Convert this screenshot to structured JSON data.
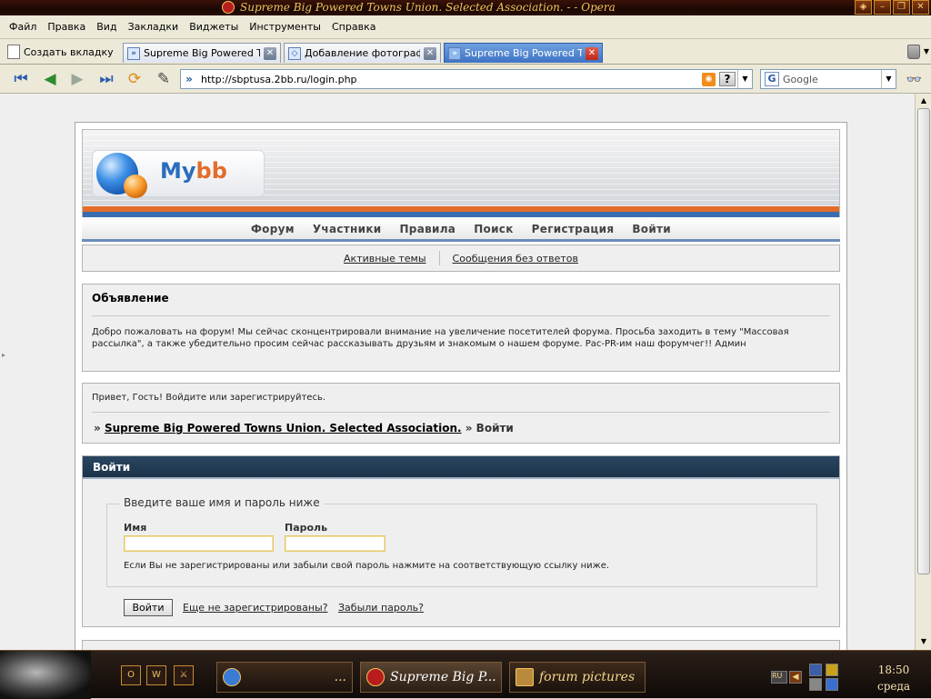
{
  "window": {
    "title": "Supreme Big Powered Towns Union. Selected Association. -      - Opera"
  },
  "menu": [
    "Файл",
    "Правка",
    "Вид",
    "Закладки",
    "Виджеты",
    "Инструменты",
    "Справка"
  ],
  "tabs": {
    "new_tab_label": "Создать вкладку",
    "items": [
      {
        "label": "Supreme Big Powered To…",
        "active": false
      },
      {
        "label": "Добавление фотограф…",
        "active": false
      },
      {
        "label": "Supreme Big Powered To…",
        "active": true
      }
    ]
  },
  "toolbar": {
    "url": "http://sbptusa.2bb.ru/login.php",
    "search_placeholder": "Google",
    "help_label": "?"
  },
  "forum": {
    "logo_text_a": "My",
    "logo_text_b": "bb",
    "nav": [
      "Форум",
      "Участники",
      "Правила",
      "Поиск",
      "Регистрация",
      "Войти"
    ],
    "subnav": [
      "Активные темы",
      "Сообщения без ответов"
    ],
    "announcement": {
      "title": "Объявление",
      "body": "Добро пожаловать на форум! Мы сейчас сконцентрировали внимание на увеличение посетителей форума. Просьба заходить в тему \"Массовая рассылка\", а также убедительно просим сейчас рассказывать друзьям и знакомым о нашем форуме. Рас-PR-им наш форумчег!! Админ"
    },
    "welcome": {
      "text": "Привет, Гость!  Войдите или зарегистрируйтесь.",
      "crumb_prefix": "»",
      "crumb_link": "Supreme Big Powered Towns Union. Selected Association.",
      "crumb_suffix": "» Войти"
    },
    "login": {
      "header": "Войти",
      "legend": "Введите ваше имя и пароль ниже",
      "name_label": "Имя",
      "password_label": "Пароль",
      "name_value": "",
      "password_value": "",
      "hint": "Если Вы не зарегистрированы или забыли свой пароль нажмите на соответствующую ссылку ниже.",
      "submit_label": "Войти",
      "register_link": "Еще не зарегистрированы?",
      "forgot_link": "Забыли пароль?"
    }
  },
  "taskbar": {
    "buttons": [
      {
        "label": "...",
        "active": false
      },
      {
        "label": "Supreme Big P...",
        "active": true
      },
      {
        "label": "forum pictures",
        "active": false
      }
    ],
    "tray_lang": "RU",
    "time": "18:50",
    "day": "среда"
  },
  "colors": {
    "accent_orange": "#e36d2a",
    "accent_blue": "#3a6db0",
    "table_header": "#1c3349"
  }
}
